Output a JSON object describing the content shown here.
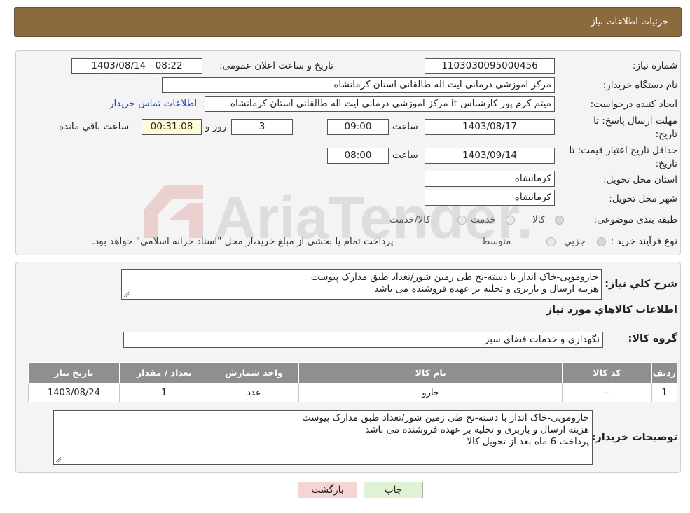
{
  "header": {
    "title": "جزئیات اطلاعات نیاز"
  },
  "form": {
    "need_number_label": "شماره نیاز:",
    "need_number": "1103030095000456",
    "announce_label": "تاریخ و ساعت اعلان عمومی:",
    "announce_value": "1403/08/14 - 08:22",
    "buyer_org_label": "نام دستگاه خریدار:",
    "buyer_org": "مرکز اموزشی درمانی ایت اله طالقانی استان کرمانشاه",
    "requester_label": "ایجاد کننده درخواست:",
    "requester": "میثم کرم پور کارشناس it مرکز اموزشی درمانی ایت اله طالقانی استان کرمانشاه",
    "contact_link": "اطلاعات تماس خریدار",
    "reply_deadline_label_1": "مهلت ارسال پاسخ: تا",
    "reply_deadline_label_2": "تاریخ:",
    "reply_date": "1403/08/17",
    "time_label": "ساعت",
    "reply_time": "09:00",
    "days": "3",
    "days_label": "روز و",
    "remaining_time": "00:31:08",
    "remaining_label": "ساعت باقي مانده",
    "price_validity_label_1": "حداقل تاریخ اعتبار قیمت: تا",
    "price_validity_label_2": "تاریخ:",
    "validity_date": "1403/09/14",
    "validity_time": "08:00",
    "province_label": "استان محل تحویل:",
    "province": "کرمانشاه",
    "city_label": "شهر محل تحویل:",
    "city": "کرمانشاه",
    "category_label": "طبقه بندی موضوعی:",
    "category_options": [
      "کالا",
      "خدمت",
      "کالا/خدمت"
    ],
    "purchase_type_label": "نوع فرآیند خرید :",
    "purchase_options": [
      "جزيي",
      "متوسط"
    ],
    "purchase_note": "پرداخت تمام یا بخشی از مبلغ خرید،از محل \"اسناد خزانه اسلامی\" خواهد بود."
  },
  "details": {
    "summary_label": "شرح کلي نياز:",
    "summary_lines": [
      "جاروموپی-خاک انداز با دسته-نخ طی زمین شور/تعداد طبق مدارک پیوست",
      "هزینه ارسال و باربری و تخلیه بر عهده فروشنده می باشد"
    ],
    "goods_info_title": "اطلاعات کالاهاي مورد نياز",
    "goods_group_label": "گروه کالا:",
    "goods_group": "نگهداری و خدمات فضای سبز",
    "table": {
      "headers": [
        "رديف",
        "کد کالا",
        "نام کالا",
        "واحد شمارش",
        "تعداد / مقدار",
        "تاریخ نیاز"
      ],
      "rows": [
        [
          "1",
          "--",
          "جارو",
          "عدد",
          "1",
          "1403/08/24"
        ]
      ]
    },
    "buyer_notes_label": "توضیحات خریدار:",
    "buyer_notes_lines": [
      "جاروموپی-خاک انداز با دسته-نخ طی زمین شور/تعداد طبق مدارک پیوست",
      "هزینه ارسال و باربری و تخلیه بر عهده فروشنده می باشد",
      "پرداخت 6 ماه بعد از تحویل کالا"
    ]
  },
  "buttons": {
    "print": "چاپ",
    "back": "بازگشت"
  },
  "watermark": {
    "text": "AriaTender.neT"
  },
  "colors": {
    "header_bg": "#8b6a3e",
    "table_header_bg": "#8f8f8f",
    "link": "#1a3fcf"
  }
}
